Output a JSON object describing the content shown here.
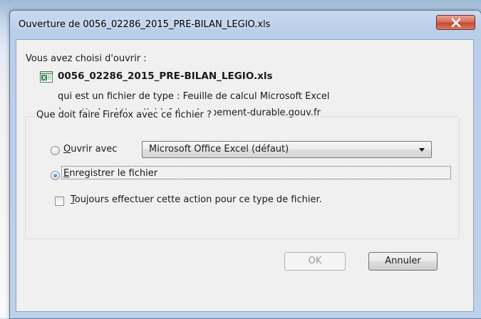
{
  "dialog": {
    "title": "Ouverture de 0056_02286_2015_PRE-BILAN_LEGIO.xls",
    "intro": "Vous avez choisi d'ouvrir :",
    "file_name": "0056_02286_2015_PRE-BILAN_LEGIO.xls",
    "file_icon": "excel-file-icon",
    "type_line": "qui est un fichier de type :  Feuille de calcul Microsoft Excel",
    "from_line": "à partir de :  https://gidaf.developpement-durable.gouv.fr",
    "group_label": "Que doit faire Firefox avec ce fichier ?",
    "open_with_access_key": "O",
    "open_with_rest": "uvrir avec",
    "open_with_selected": false,
    "app_select_value": "Microsoft Office Excel (défaut)",
    "save_access_key": "E",
    "save_rest": "nregistrer le fichier",
    "save_selected": true,
    "always_access_key": "T",
    "always_rest": "oujours effectuer cette action pour ce type de fichier.",
    "always_checked": false,
    "ok_label": "OK",
    "ok_enabled": false,
    "cancel_label": "Annuler"
  },
  "colors": {
    "close_button": "#c34a33",
    "radio_dot": "#1a5fb4",
    "excel_green": "#1e7145"
  }
}
